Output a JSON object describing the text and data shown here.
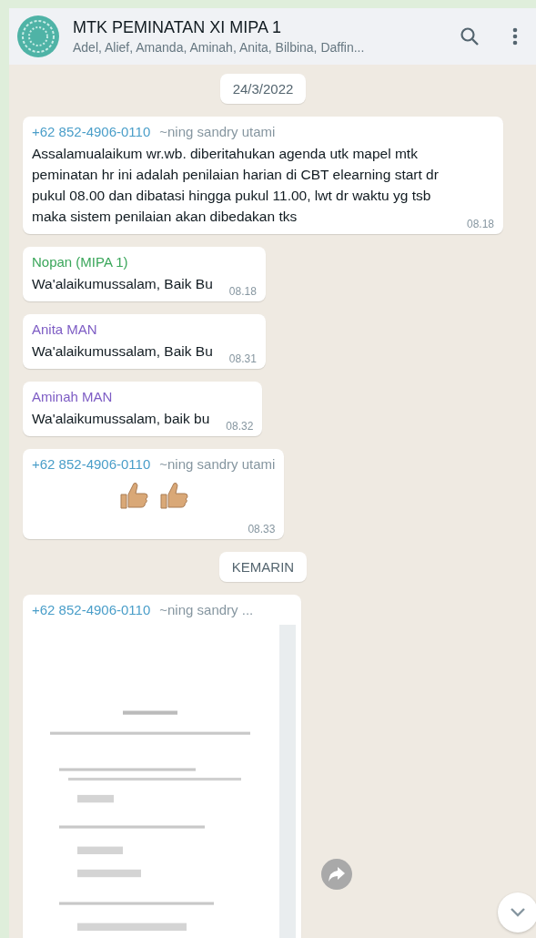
{
  "header": {
    "title": "MTK PEMINATAN XI MIPA 1",
    "subtitle": "Adel, Alief, Amanda, Aminah, Anita, Bilbina, Daffin..."
  },
  "messages": [
    {
      "kind": "date",
      "text": "24/3/2022"
    },
    {
      "kind": "text",
      "sender": {
        "name": "+62 852-4906-0110",
        "color": "#4a9ec9",
        "push_name": "~ning sandry utami"
      },
      "text": "Assalamualaikum wr.wb. diberitahukan agenda utk mapel mtk peminatan hr ini adalah penilaian harian di CBT elearning start dr pukul 08.00 dan dibatasi hingga pukul 11.00, lwt dr waktu yg tsb maka sistem penilaian akan dibedakan tks",
      "time": "08.18"
    },
    {
      "kind": "text",
      "sender": {
        "name": "Nopan (MIPA 1)",
        "color": "#3aa65a"
      },
      "text": "Wa'alaikumussalam, Baik Bu",
      "time": "08.18"
    },
    {
      "kind": "text",
      "sender": {
        "name": "Anita MAN",
        "color": "#7d5cc4"
      },
      "text": "Wa'alaikumussalam, Baik Bu",
      "time": "08.31"
    },
    {
      "kind": "text",
      "sender": {
        "name": "Aminah MAN",
        "color": "#7d5cc4"
      },
      "text": "Wa'alaikumussalam, baik bu",
      "time": "08.32"
    },
    {
      "kind": "emoji",
      "sender": {
        "name": "+62 852-4906-0110",
        "color": "#4a9ec9",
        "push_name": "~ning sandry utami"
      },
      "time": "08.33"
    },
    {
      "kind": "date",
      "text": "KEMARIN"
    },
    {
      "sender": {
        "name": "+62 852-4906-0110",
        "color": "#4a9ec9",
        "push_name": "~ning sandry ..."
      }
    }
  ]
}
